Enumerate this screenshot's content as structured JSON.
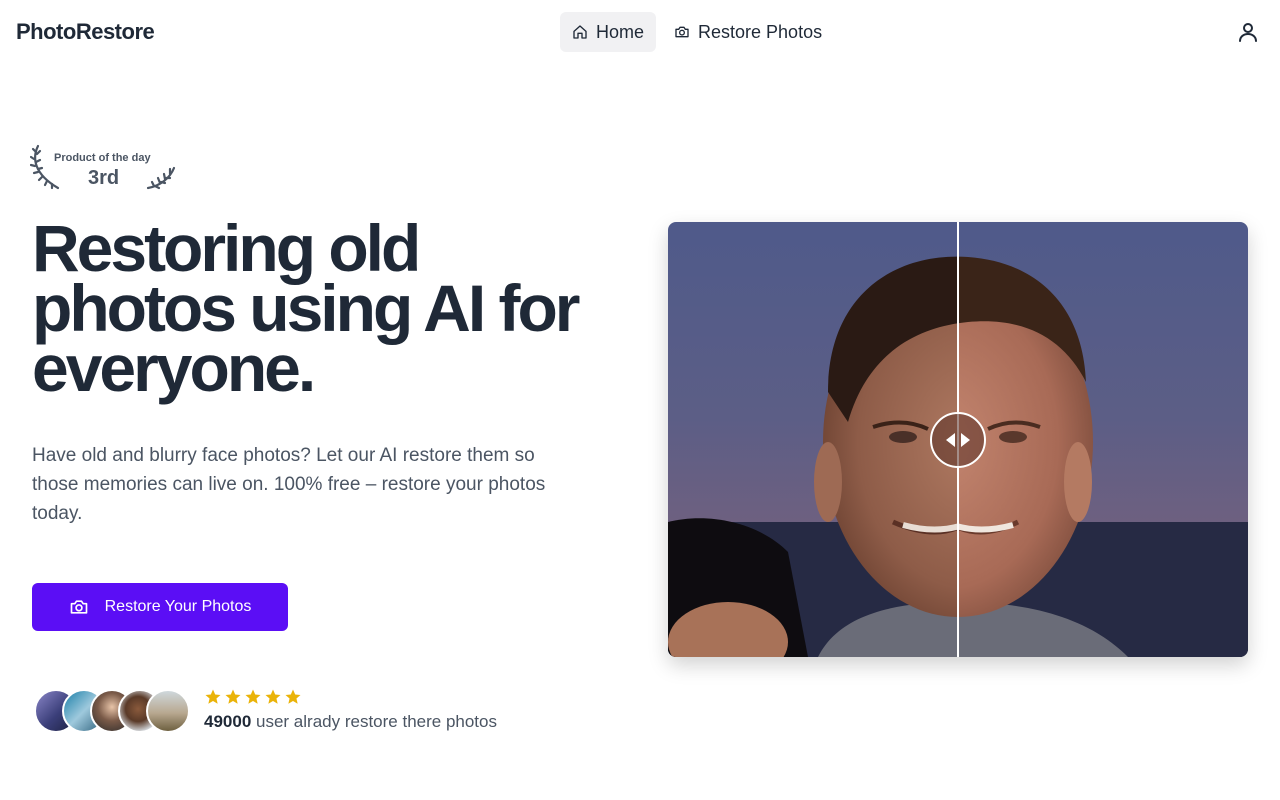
{
  "header": {
    "logo": "PhotoRestore",
    "nav": [
      {
        "label": "Home",
        "icon": "home-icon",
        "active": true
      },
      {
        "label": "Restore Photos",
        "icon": "camera-icon",
        "active": false
      }
    ],
    "user_icon": "user-icon"
  },
  "badge": {
    "label": "Product of the day",
    "rank": "3rd"
  },
  "hero": {
    "title": "Restoring old photos using AI for everyone.",
    "description": "Have old and blurry face photos? Let our AI restore them so those memories can live on. 100% free – restore your photos today.",
    "cta_label": "Restore Your Photos"
  },
  "social_proof": {
    "rating": 5,
    "count": "49000",
    "text": "user alrady restore there photos"
  },
  "compare": {
    "split_fraction": 0.5
  },
  "colors": {
    "accent": "#5b0ef5",
    "star": "#eab308",
    "heading": "#1f2937",
    "body_text": "#4b5563"
  }
}
